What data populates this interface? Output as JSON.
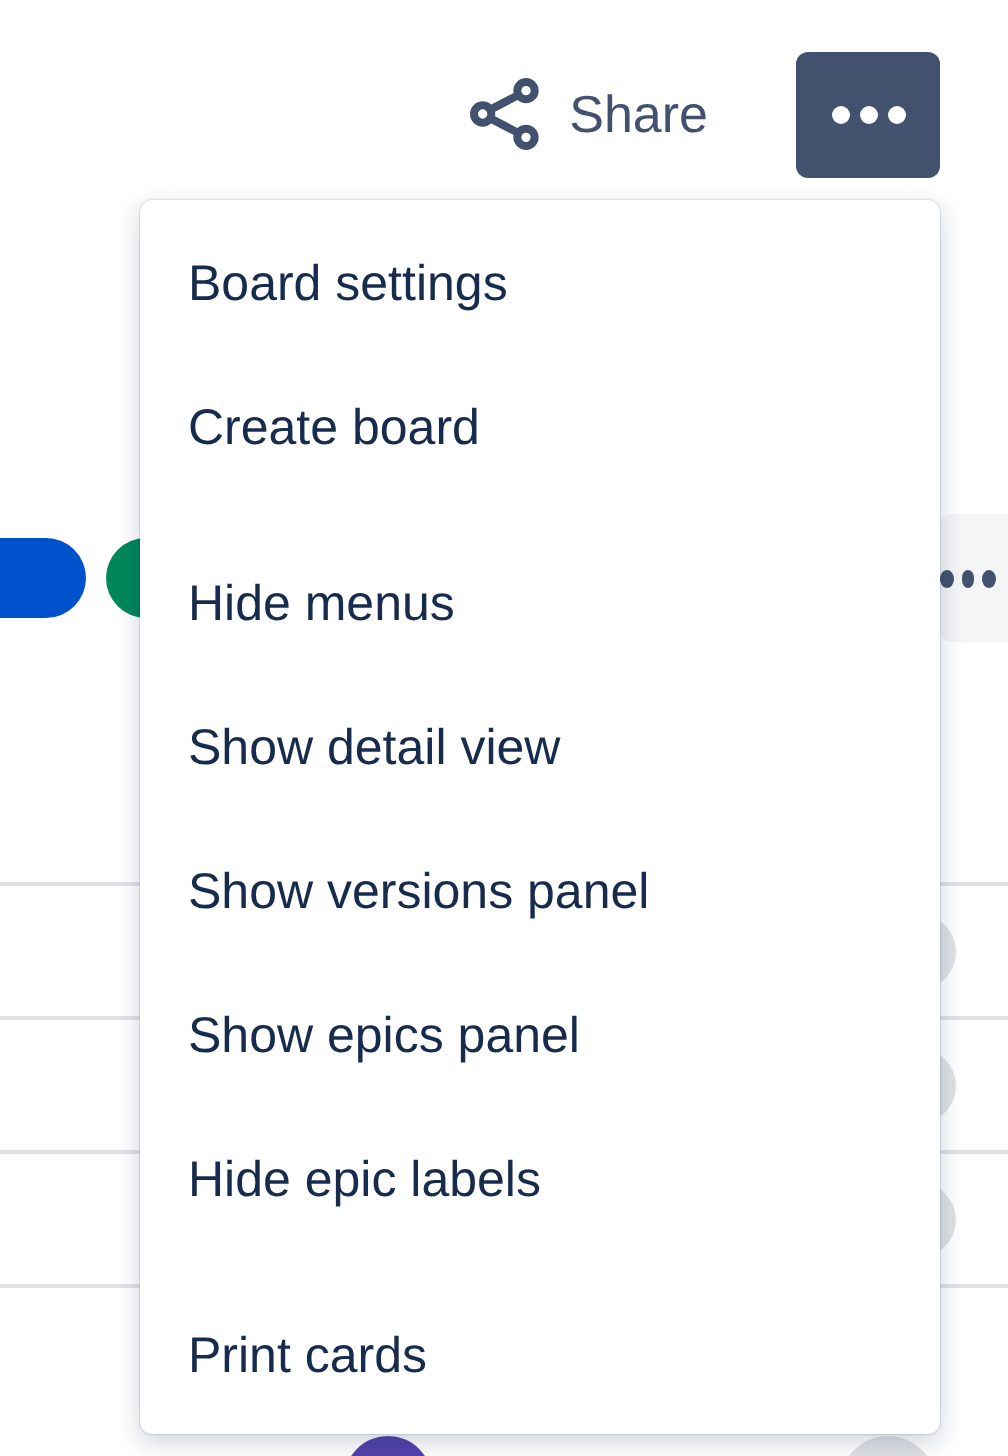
{
  "toolbar": {
    "share_label": "Share"
  },
  "menu": {
    "groups": [
      {
        "items": [
          "Board settings",
          "Create board"
        ]
      },
      {
        "items": [
          "Hide menus",
          "Show detail view",
          "Show versions panel",
          "Show epics panel",
          "Hide epic labels"
        ]
      },
      {
        "items": [
          "Print cards"
        ]
      }
    ]
  }
}
